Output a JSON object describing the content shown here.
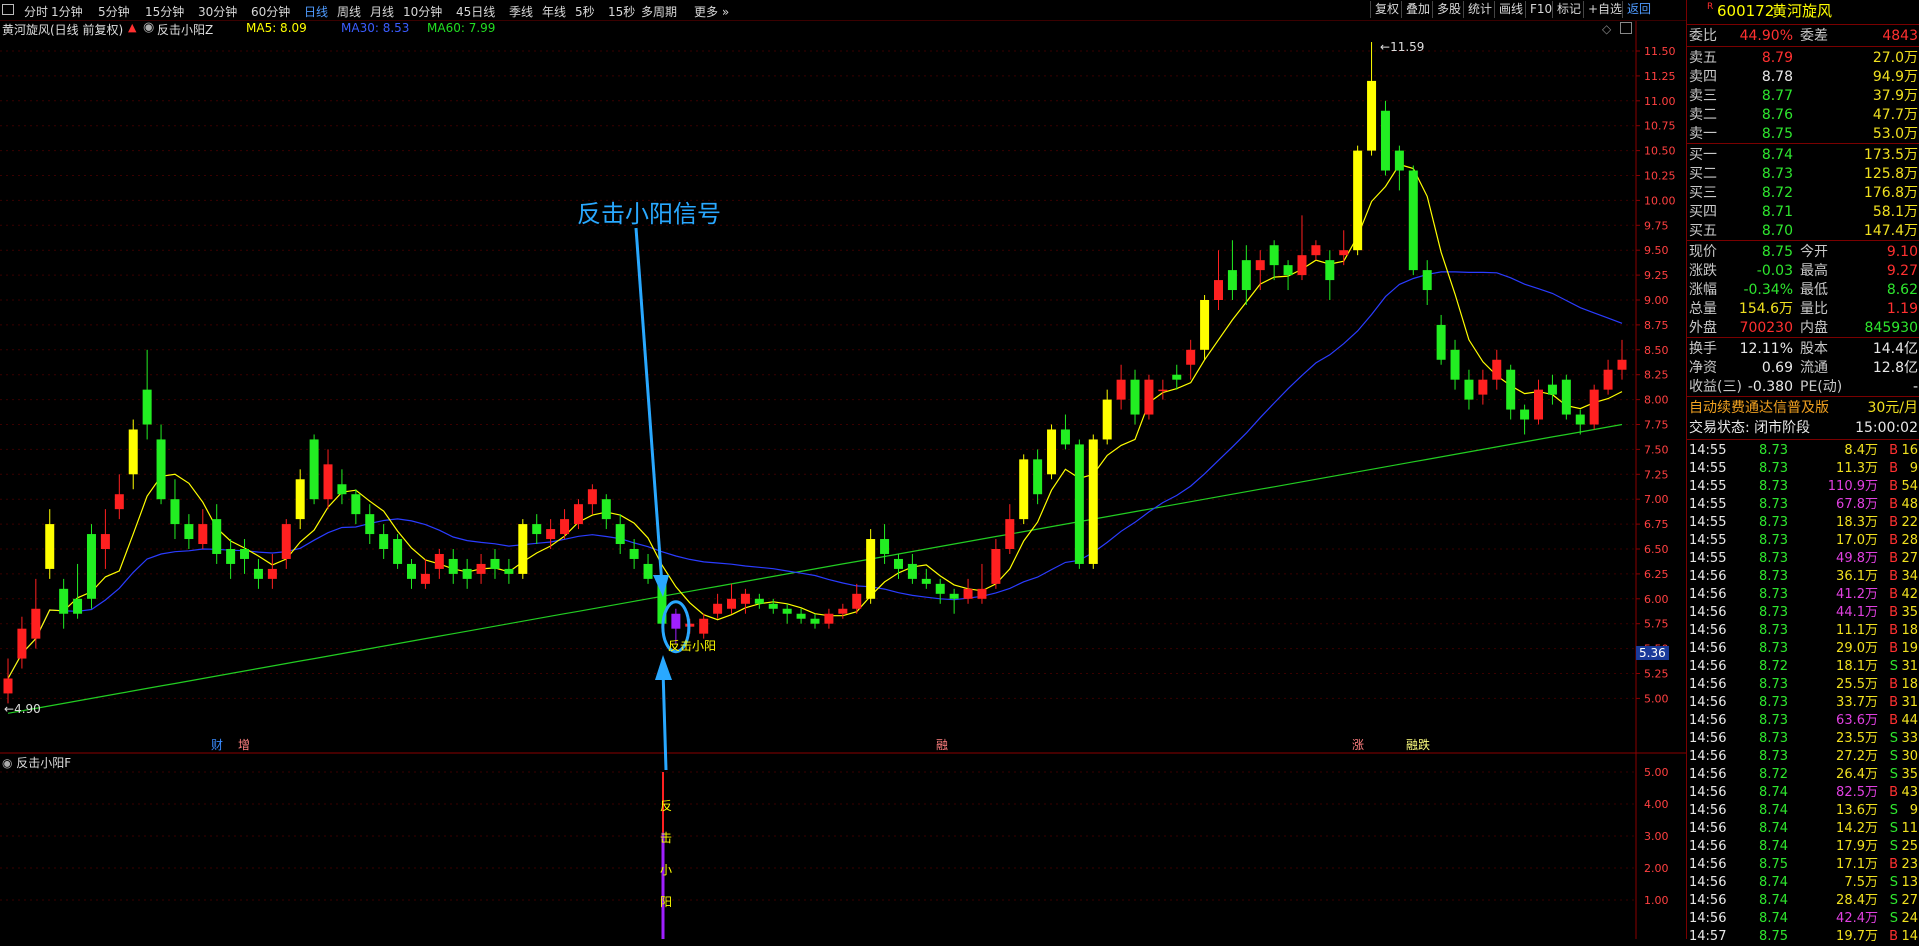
{
  "toolbar": {
    "periods": [
      {
        "label": "分时",
        "active": false
      },
      {
        "label": "1分钟",
        "active": false
      },
      {
        "label": "5分钟",
        "active": false
      },
      {
        "label": "15分钟",
        "active": false
      },
      {
        "label": "30分钟",
        "active": false
      },
      {
        "label": "60分钟",
        "active": false
      },
      {
        "label": "日线",
        "active": true
      },
      {
        "label": "周线",
        "active": false
      },
      {
        "label": "月线",
        "active": false
      },
      {
        "label": "10分钟",
        "active": false
      },
      {
        "label": "45日线",
        "active": false
      },
      {
        "label": "季线",
        "active": false
      },
      {
        "label": "年线",
        "active": false
      },
      {
        "label": "5秒",
        "active": false
      },
      {
        "label": "15秒",
        "active": false
      },
      {
        "label": "多周期",
        "active": false
      },
      {
        "label": "更多",
        "active": false
      }
    ],
    "right_buttons": [
      "复权",
      "叠加",
      "多股",
      "统计",
      "画线",
      "F10",
      "标记",
      "+自选",
      "返回"
    ]
  },
  "chart": {
    "stock_label": "黄河旋风(日线 前复权)",
    "indicator_name": "反击小阳Z",
    "ma5": "MA5: 8.09",
    "ma30": "MA30: 8.53",
    "ma60": "MA60: 7.99",
    "high_mark": "11.59",
    "low_mark": "4.90",
    "current_price_tag": "5.36",
    "annotation": "反击小阳信号",
    "signal_text": "反击小阳",
    "event_markers": [
      "财",
      "增",
      "融",
      "涨",
      "融跌"
    ],
    "sub_indicator_name": "反击小阳F",
    "sub_chars": [
      "反",
      "击",
      "小",
      "阳"
    ],
    "price_ticks": [
      "11.50",
      "11.25",
      "11.00",
      "10.75",
      "10.50",
      "10.25",
      "10.00",
      "9.75",
      "9.50",
      "9.25",
      "9.00",
      "8.75",
      "8.50",
      "8.25",
      "8.00",
      "7.75",
      "7.50",
      "7.25",
      "7.00",
      "6.75",
      "6.50",
      "6.25",
      "6.00",
      "5.75",
      "5.50",
      "5.25",
      "5.00"
    ],
    "sub_ticks": [
      "5.00",
      "4.00",
      "3.00",
      "2.00",
      "1.00"
    ],
    "colors": {
      "up": "#ff2020",
      "down": "#22ee22",
      "yellow_up": "#ffff00",
      "ma5": "#ffff00",
      "ma30": "#2a3cff",
      "ma60": "#22cc22",
      "signal": "#a020ff"
    }
  },
  "chart_data": {
    "type": "candlestick",
    "title": "",
    "ylim": [
      4.5,
      11.7
    ],
    "candles": [
      [
        5.05,
        5.2,
        5.4,
        4.95
      ],
      [
        5.4,
        5.7,
        5.82,
        5.3
      ],
      [
        5.6,
        5.9,
        6.2,
        5.5
      ],
      [
        6.3,
        6.75,
        6.9,
        6.2
      ],
      [
        6.1,
        5.85,
        6.2,
        5.7
      ],
      [
        6.0,
        5.85,
        6.35,
        5.8
      ],
      [
        6.65,
        6.0,
        6.75,
        5.9
      ],
      [
        6.5,
        6.65,
        6.9,
        6.3
      ],
      [
        6.9,
        7.05,
        7.25,
        6.8
      ],
      [
        7.25,
        7.7,
        7.8,
        7.1
      ],
      [
        8.1,
        7.75,
        8.5,
        7.6
      ],
      [
        7.6,
        7.0,
        7.75,
        6.95
      ],
      [
        7.0,
        6.75,
        7.2,
        6.6
      ],
      [
        6.75,
        6.6,
        6.85,
        6.5
      ],
      [
        6.55,
        6.75,
        6.9,
        6.5
      ],
      [
        6.8,
        6.45,
        6.95,
        6.35
      ],
      [
        6.5,
        6.35,
        6.6,
        6.2
      ],
      [
        6.5,
        6.4,
        6.6,
        6.25
      ],
      [
        6.3,
        6.2,
        6.4,
        6.1
      ],
      [
        6.2,
        6.3,
        6.45,
        6.1
      ],
      [
        6.4,
        6.75,
        6.8,
        6.3
      ],
      [
        6.8,
        7.2,
        7.3,
        6.7
      ],
      [
        7.6,
        7.0,
        7.65,
        6.95
      ],
      [
        7.0,
        7.35,
        7.5,
        6.9
      ],
      [
        7.15,
        7.05,
        7.3,
        6.95
      ],
      [
        7.05,
        6.85,
        7.1,
        6.75
      ],
      [
        6.85,
        6.65,
        6.95,
        6.55
      ],
      [
        6.65,
        6.5,
        6.75,
        6.4
      ],
      [
        6.6,
        6.35,
        6.65,
        6.3
      ],
      [
        6.35,
        6.2,
        6.4,
        6.1
      ],
      [
        6.15,
        6.25,
        6.4,
        6.1
      ],
      [
        6.3,
        6.45,
        6.5,
        6.2
      ],
      [
        6.4,
        6.25,
        6.5,
        6.15
      ],
      [
        6.3,
        6.2,
        6.4,
        6.1
      ],
      [
        6.25,
        6.35,
        6.45,
        6.15
      ],
      [
        6.4,
        6.3,
        6.5,
        6.2
      ],
      [
        6.3,
        6.25,
        6.4,
        6.15
      ],
      [
        6.25,
        6.75,
        6.8,
        6.2
      ],
      [
        6.75,
        6.65,
        6.85,
        6.55
      ],
      [
        6.6,
        6.7,
        6.8,
        6.5
      ],
      [
        6.65,
        6.8,
        6.9,
        6.6
      ],
      [
        6.75,
        6.95,
        7.0,
        6.7
      ],
      [
        6.95,
        7.1,
        7.15,
        6.85
      ],
      [
        7.0,
        6.8,
        7.05,
        6.7
      ],
      [
        6.75,
        6.55,
        6.85,
        6.45
      ],
      [
        6.5,
        6.4,
        6.6,
        6.3
      ],
      [
        6.35,
        6.2,
        6.45,
        6.15
      ],
      [
        6.2,
        5.75,
        6.25,
        5.7
      ],
      [
        5.85,
        5.7,
        5.9,
        5.55
      ],
      [
        5.72,
        5.75,
        5.8,
        5.65
      ],
      [
        5.65,
        5.8,
        5.85,
        5.6
      ],
      [
        5.85,
        5.95,
        6.05,
        5.8
      ],
      [
        5.9,
        6.0,
        6.15,
        5.85
      ],
      [
        5.95,
        6.05,
        6.1,
        5.85
      ],
      [
        6.0,
        5.95,
        6.05,
        5.9
      ],
      [
        5.95,
        5.9,
        6.0,
        5.85
      ],
      [
        5.9,
        5.85,
        5.95,
        5.75
      ],
      [
        5.85,
        5.8,
        5.9,
        5.75
      ],
      [
        5.8,
        5.75,
        5.85,
        5.7
      ],
      [
        5.75,
        5.85,
        5.9,
        5.7
      ],
      [
        5.85,
        5.9,
        5.95,
        5.8
      ],
      [
        5.9,
        6.05,
        6.15,
        5.85
      ],
      [
        6.0,
        6.6,
        6.7,
        5.95
      ],
      [
        6.6,
        6.45,
        6.75,
        6.35
      ],
      [
        6.4,
        6.3,
        6.45,
        6.2
      ],
      [
        6.35,
        6.2,
        6.45,
        6.15
      ],
      [
        6.2,
        6.15,
        6.3,
        6.1
      ],
      [
        6.15,
        6.05,
        6.2,
        5.95
      ],
      [
        6.05,
        6.0,
        6.1,
        5.85
      ],
      [
        6.0,
        6.1,
        6.2,
        5.95
      ],
      [
        6.0,
        6.1,
        6.35,
        5.95
      ],
      [
        6.15,
        6.5,
        6.6,
        6.1
      ],
      [
        6.5,
        6.8,
        6.95,
        6.45
      ],
      [
        6.8,
        7.4,
        7.45,
        6.75
      ],
      [
        7.4,
        7.05,
        7.5,
        6.95
      ],
      [
        7.25,
        7.7,
        7.75,
        7.2
      ],
      [
        7.7,
        7.55,
        7.85,
        7.5
      ],
      [
        7.55,
        6.35,
        7.6,
        6.3
      ],
      [
        6.35,
        7.6,
        7.65,
        6.3
      ],
      [
        7.6,
        8.0,
        8.1,
        7.55
      ],
      [
        8.0,
        8.2,
        8.35,
        7.9
      ],
      [
        8.2,
        7.85,
        8.3,
        7.75
      ],
      [
        7.85,
        8.2,
        8.25,
        7.8
      ],
      [
        8.1,
        8.1,
        8.2,
        8.0
      ],
      [
        8.25,
        8.2,
        8.35,
        8.1
      ],
      [
        8.35,
        8.5,
        8.6,
        8.2
      ],
      [
        8.5,
        9.0,
        9.05,
        8.4
      ],
      [
        9.0,
        9.2,
        9.5,
        8.9
      ],
      [
        9.3,
        9.1,
        9.6,
        9.0
      ],
      [
        9.4,
        9.1,
        9.55,
        8.95
      ],
      [
        9.3,
        9.4,
        9.5,
        9.1
      ],
      [
        9.55,
        9.35,
        9.6,
        9.2
      ],
      [
        9.35,
        9.25,
        9.4,
        9.1
      ],
      [
        9.25,
        9.45,
        9.85,
        9.2
      ],
      [
        9.45,
        9.55,
        9.6,
        9.4
      ],
      [
        9.4,
        9.2,
        9.5,
        9.0
      ],
      [
        9.45,
        9.5,
        9.7,
        9.35
      ],
      [
        9.5,
        10.5,
        10.55,
        9.45
      ],
      [
        10.5,
        11.2,
        11.59,
        10.45
      ],
      [
        10.9,
        10.3,
        11.0,
        10.25
      ],
      [
        10.5,
        10.3,
        10.55,
        10.1
      ],
      [
        10.3,
        9.3,
        10.35,
        9.25
      ],
      [
        9.3,
        9.1,
        9.4,
        8.95
      ],
      [
        8.75,
        8.4,
        8.85,
        8.35
      ],
      [
        8.5,
        8.2,
        8.6,
        8.1
      ],
      [
        8.2,
        8.0,
        8.3,
        7.9
      ],
      [
        8.05,
        8.2,
        8.3,
        7.95
      ],
      [
        8.2,
        8.4,
        8.5,
        8.1
      ],
      [
        8.3,
        7.9,
        8.35,
        7.8
      ],
      [
        7.9,
        7.8,
        7.95,
        7.65
      ],
      [
        7.8,
        8.1,
        8.2,
        7.75
      ],
      [
        8.15,
        8.05,
        8.25,
        7.95
      ],
      [
        8.2,
        7.85,
        8.25,
        7.8
      ],
      [
        7.85,
        7.75,
        7.9,
        7.65
      ],
      [
        7.75,
        8.1,
        8.15,
        7.7
      ],
      [
        8.1,
        8.3,
        8.4,
        8.05
      ],
      [
        8.3,
        8.4,
        8.6,
        8.2
      ]
    ]
  },
  "panel": {
    "code": "600172",
    "name": "黄河旋风",
    "wei_bi_label": "委比",
    "wei_bi": "44.90%",
    "wei_cha_label": "委差",
    "wei_cha": "4843",
    "asks": [
      {
        "label": "卖五",
        "price": "8.79",
        "vol": "27.0万"
      },
      {
        "label": "卖四",
        "price": "8.78",
        "vol": "94.9万"
      },
      {
        "label": "卖三",
        "price": "8.77",
        "vol": "37.9万"
      },
      {
        "label": "卖二",
        "price": "8.76",
        "vol": "47.7万"
      },
      {
        "label": "卖一",
        "price": "8.75",
        "vol": "53.0万"
      }
    ],
    "bids": [
      {
        "label": "买一",
        "price": "8.74",
        "vol": "173.5万"
      },
      {
        "label": "买二",
        "price": "8.73",
        "vol": "125.8万"
      },
      {
        "label": "买三",
        "price": "8.72",
        "vol": "176.8万"
      },
      {
        "label": "买四",
        "price": "8.71",
        "vol": "58.1万"
      },
      {
        "label": "买五",
        "price": "8.70",
        "vol": "147.4万"
      }
    ],
    "quote": [
      {
        "l1": "现价",
        "v1": "8.75",
        "l2": "今开",
        "v2": "9.10"
      },
      {
        "l1": "涨跌",
        "v1": "-0.03",
        "l2": "最高",
        "v2": "9.27"
      },
      {
        "l1": "涨幅",
        "v1": "-0.34%",
        "l2": "最低",
        "v2": "8.62"
      },
      {
        "l1": "总量",
        "v1": "154.6万",
        "l2": "量比",
        "v2": "1.19"
      },
      {
        "l1": "外盘",
        "v1": "700230",
        "l2": "内盘",
        "v2": "845930"
      }
    ],
    "fund": [
      {
        "l1": "换手",
        "v1": "12.11%",
        "l2": "股本",
        "v2": "14.4亿"
      },
      {
        "l1": "净资",
        "v1": "0.69",
        "l2": "流通",
        "v2": "12.8亿"
      },
      {
        "l1": "收益(三)",
        "v1": "-0.380",
        "l2": "PE(动)",
        "v2": "-"
      }
    ],
    "ad": "自动续费通达信普及版",
    "ad_price": "30元/月",
    "trade_status": "交易状态: 闭市阶段",
    "trade_time": "15:00:02",
    "ticks": [
      [
        "14:55",
        "8.73",
        "8.4万",
        "B",
        "16"
      ],
      [
        "14:55",
        "8.73",
        "11.3万",
        "B",
        "9"
      ],
      [
        "14:55",
        "8.73",
        "110.9万",
        "B",
        "54"
      ],
      [
        "14:55",
        "8.73",
        "67.8万",
        "B",
        "48"
      ],
      [
        "14:55",
        "8.73",
        "18.3万",
        "B",
        "22"
      ],
      [
        "14:55",
        "8.73",
        "17.0万",
        "B",
        "28"
      ],
      [
        "14:55",
        "8.73",
        "49.8万",
        "B",
        "27"
      ],
      [
        "14:56",
        "8.73",
        "36.1万",
        "B",
        "34"
      ],
      [
        "14:56",
        "8.73",
        "41.2万",
        "B",
        "42"
      ],
      [
        "14:56",
        "8.73",
        "44.1万",
        "B",
        "35"
      ],
      [
        "14:56",
        "8.73",
        "11.1万",
        "B",
        "18"
      ],
      [
        "14:56",
        "8.73",
        "29.0万",
        "B",
        "19"
      ],
      [
        "14:56",
        "8.72",
        "18.1万",
        "S",
        "31"
      ],
      [
        "14:56",
        "8.73",
        "25.5万",
        "B",
        "18"
      ],
      [
        "14:56",
        "8.73",
        "33.7万",
        "B",
        "31"
      ],
      [
        "14:56",
        "8.73",
        "63.6万",
        "B",
        "44"
      ],
      [
        "14:56",
        "8.73",
        "23.5万",
        "S",
        "33"
      ],
      [
        "14:56",
        "8.73",
        "27.2万",
        "S",
        "30"
      ],
      [
        "14:56",
        "8.72",
        "26.4万",
        "S",
        "35"
      ],
      [
        "14:56",
        "8.74",
        "82.5万",
        "B",
        "43"
      ],
      [
        "14:56",
        "8.74",
        "13.6万",
        "S",
        "9"
      ],
      [
        "14:56",
        "8.74",
        "14.2万",
        "S",
        "11"
      ],
      [
        "14:56",
        "8.74",
        "17.9万",
        "S",
        "25"
      ],
      [
        "14:56",
        "8.75",
        "17.1万",
        "B",
        "23"
      ],
      [
        "14:56",
        "8.74",
        "7.5万",
        "S",
        "13"
      ],
      [
        "14:56",
        "8.74",
        "28.4万",
        "S",
        "27"
      ],
      [
        "14:56",
        "8.74",
        "42.4万",
        "S",
        "24"
      ],
      [
        "14:57",
        "8.75",
        "19.7万",
        "B",
        "14"
      ]
    ]
  }
}
